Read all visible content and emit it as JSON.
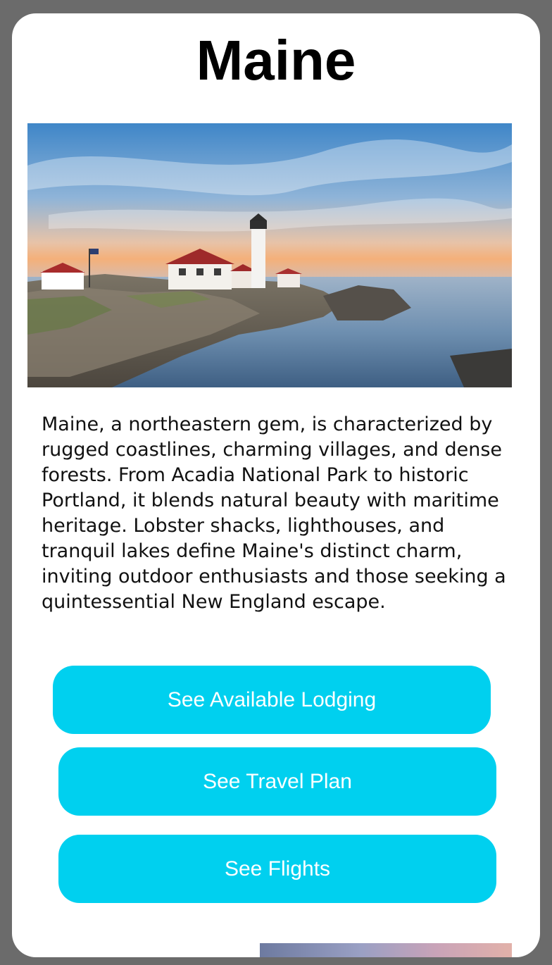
{
  "page": {
    "title": "Maine",
    "hero_alt": "Portland Head Light lighthouse on a rocky coastline at sunset",
    "description": "Maine, a northeastern gem, is characterized by rugged coastlines, charming villages, and dense forests. From Acadia National Park to historic Portland, it blends natural beauty with maritime heritage. Lobster shacks, lighthouses, and tranquil lakes define Maine's distinct charm, inviting outdoor enthusiasts and those seeking a quintessential New England escape."
  },
  "actions": {
    "lodging_label": "See Available Lodging",
    "plan_label": "See Travel Plan",
    "flights_label": "See Flights"
  },
  "colors": {
    "button": "#00d0ef",
    "button_text": "#ffffff",
    "background_frame": "#6b6b6b",
    "card": "#ffffff"
  }
}
